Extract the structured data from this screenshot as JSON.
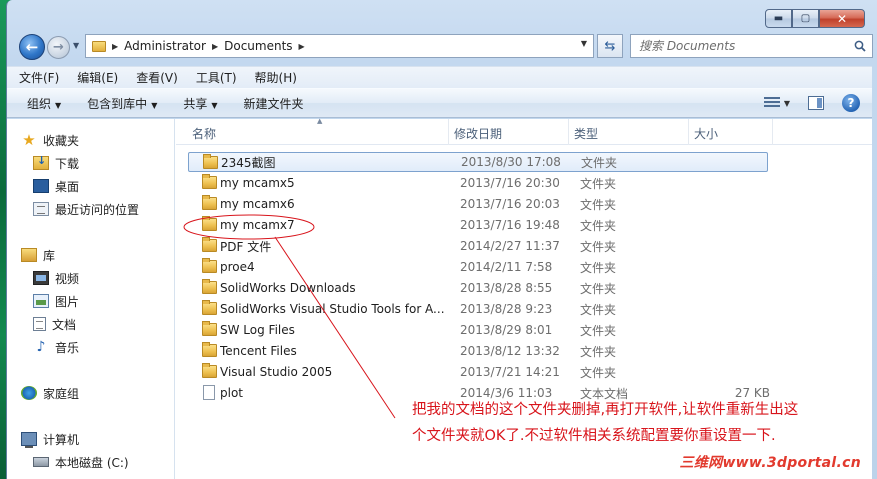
{
  "window": {
    "caption": {
      "minimize": "▬",
      "maximize": "▢",
      "close": "✕"
    }
  },
  "address": {
    "crumbs": [
      "Administrator",
      "Documents"
    ],
    "search_placeholder": "搜索 Documents"
  },
  "menu": [
    "文件(F)",
    "编辑(E)",
    "查看(V)",
    "工具(T)",
    "帮助(H)"
  ],
  "commands": {
    "organize": "组织",
    "include_library": "包含到库中",
    "share": "共享",
    "new_folder": "新建文件夹"
  },
  "nav": {
    "favorites": "收藏夹",
    "downloads": "下载",
    "desktop": "桌面",
    "recent": "最近访问的位置",
    "libraries": "库",
    "videos": "视频",
    "pictures": "图片",
    "documents": "文档",
    "music": "音乐",
    "homegroup": "家庭组",
    "computer": "计算机",
    "local_disk": "本地磁盘 (C:)"
  },
  "columns": {
    "name": "名称",
    "date": "修改日期",
    "type": "类型",
    "size": "大小"
  },
  "files": [
    {
      "name": "2345截图",
      "date": "2013/8/30 17:08",
      "type": "文件夹",
      "size": "",
      "kind": "folder",
      "selected": true
    },
    {
      "name": "my mcamx5",
      "date": "2013/7/16 20:30",
      "type": "文件夹",
      "size": "",
      "kind": "folder"
    },
    {
      "name": "my mcamx6",
      "date": "2013/7/16 20:03",
      "type": "文件夹",
      "size": "",
      "kind": "folder"
    },
    {
      "name": "my mcamx7",
      "date": "2013/7/16 19:48",
      "type": "文件夹",
      "size": "",
      "kind": "folder"
    },
    {
      "name": "PDF 文件",
      "date": "2014/2/27 11:37",
      "type": "文件夹",
      "size": "",
      "kind": "folder"
    },
    {
      "name": "proe4",
      "date": "2014/2/11 7:58",
      "type": "文件夹",
      "size": "",
      "kind": "folder"
    },
    {
      "name": "SolidWorks Downloads",
      "date": "2013/8/28 8:55",
      "type": "文件夹",
      "size": "",
      "kind": "folder"
    },
    {
      "name": "SolidWorks Visual Studio Tools for A...",
      "date": "2013/8/28 9:23",
      "type": "文件夹",
      "size": "",
      "kind": "folder"
    },
    {
      "name": "SW Log Files",
      "date": "2013/8/29 8:01",
      "type": "文件夹",
      "size": "",
      "kind": "folder"
    },
    {
      "name": "Tencent Files",
      "date": "2013/8/12 13:32",
      "type": "文件夹",
      "size": "",
      "kind": "folder"
    },
    {
      "name": "Visual Studio 2005",
      "date": "2013/7/21 14:21",
      "type": "文件夹",
      "size": "",
      "kind": "folder"
    },
    {
      "name": "plot",
      "date": "2014/3/6 11:03",
      "type": "文本文档",
      "size": "27 KB",
      "kind": "file"
    }
  ],
  "annotation": {
    "text": "把我的文档的这个文件夹删掉,再打开软件,让软件重新生出这个文件夹就OK了.不过软件相关系统配置要你重设置一下.",
    "color": "#d8141b"
  },
  "watermark": "三维网www.3dportal.cn"
}
